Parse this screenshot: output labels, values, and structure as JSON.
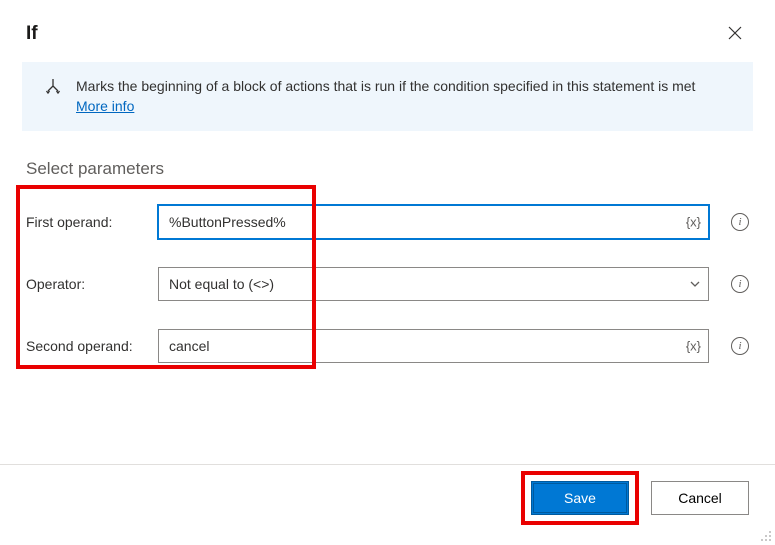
{
  "header": {
    "title": "If"
  },
  "info": {
    "text": "Marks the beginning of a block of actions that is run if the condition specified in this statement is met",
    "more_link": "More info"
  },
  "section_title": "Select parameters",
  "params": {
    "first_operand": {
      "label": "First operand:",
      "value": "%ButtonPressed%"
    },
    "operator": {
      "label": "Operator:",
      "value": "Not equal to (<>)"
    },
    "second_operand": {
      "label": "Second operand:",
      "value": "cancel"
    }
  },
  "icons": {
    "variable_token": "{x}"
  },
  "footer": {
    "save_label": "Save",
    "cancel_label": "Cancel"
  }
}
